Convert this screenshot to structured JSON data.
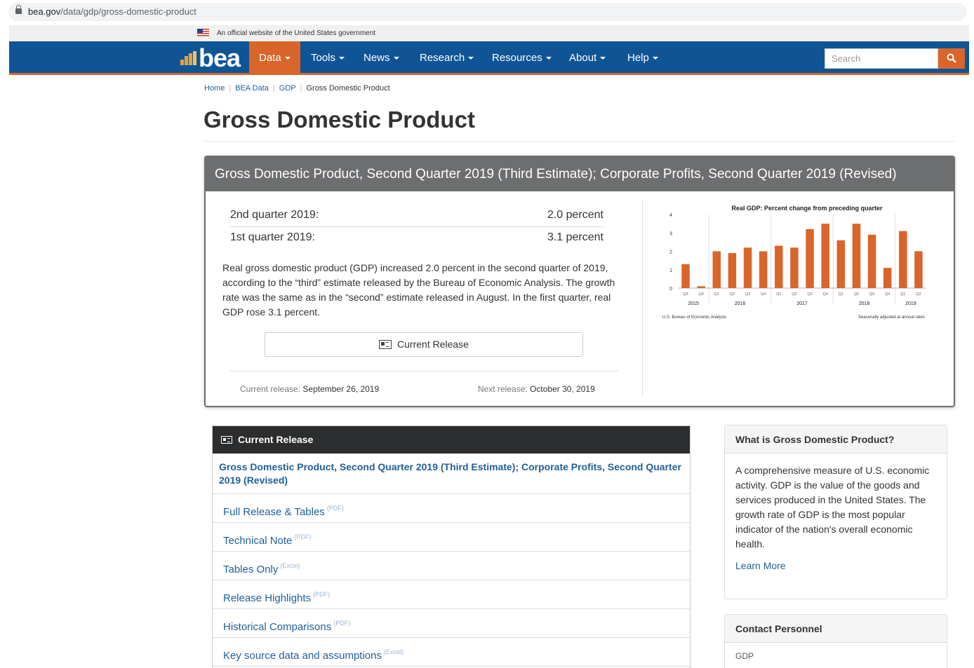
{
  "browser": {
    "url_domain": "bea.gov",
    "url_path": "/data/gdp/gross-domestic-product"
  },
  "gov_banner": "An official website of the United States government",
  "nav": {
    "logo": "bea",
    "items": [
      "Data",
      "Tools",
      "News",
      "Research",
      "Resources",
      "About",
      "Help"
    ],
    "active": "Data",
    "search_placeholder": "Search"
  },
  "breadcrumb": [
    "Home",
    "BEA Data",
    "GDP",
    "Gross Domestic Product"
  ],
  "page_title": "Gross Domestic Product",
  "feature": {
    "heading": "Gross Domestic Product, Second Quarter 2019 (Third Estimate); Corporate Profits, Second Quarter 2019 (Revised)",
    "stats": [
      {
        "label": "2nd quarter 2019:",
        "value": "2.0 percent"
      },
      {
        "label": "1st quarter 2019:",
        "value": "3.1 percent"
      }
    ],
    "summary": "Real gross domestic product (GDP) increased 2.0 percent in the second quarter of 2019, according to the “third” estimate released by the Bureau of Economic Analysis. The growth rate was the same as in the “second” estimate released in August. In the first quarter, real GDP rose 3.1 percent.",
    "button": "Current Release",
    "current_release_label": "Current release:",
    "current_release_date": "September 26, 2019",
    "next_release_label": "Next release:",
    "next_release_date": "October 30, 2019"
  },
  "chart_data": {
    "type": "bar",
    "title": "Real GDP:  Percent change from preceding quarter",
    "categories": [
      "Q3",
      "Q4",
      "Q1",
      "Q2",
      "Q3",
      "Q4",
      "Q1",
      "Q2",
      "Q3",
      "Q4",
      "Q1",
      "Q2",
      "Q3",
      "Q4",
      "Q1",
      "Q2"
    ],
    "years": [
      "2015",
      "2016",
      "2017",
      "2018",
      "2019"
    ],
    "values": [
      1.3,
      0.1,
      2.0,
      1.9,
      2.2,
      2.0,
      2.3,
      2.2,
      3.2,
      3.5,
      2.6,
      3.5,
      2.9,
      1.1,
      3.1,
      2.0
    ],
    "yticks": [
      "0",
      "1",
      "2",
      "3",
      "4"
    ],
    "ylim": [
      0,
      4
    ],
    "bar_color": "#d9652b",
    "source_note": "U.S. Bureau of Economic Analysis",
    "note": "Seasonally adjusted at annual rates"
  },
  "current_release_box": {
    "heading": "Current Release",
    "title": "Gross Domestic Product, Second Quarter 2019 (Third Estimate); Corporate Profits, Second Quarter 2019 (Revised)",
    "links": [
      {
        "label": "Full Release & Tables",
        "tag": "(PDF)"
      },
      {
        "label": "Technical Note",
        "tag": "(PDF)"
      },
      {
        "label": "Tables Only",
        "tag": "(Excel)"
      },
      {
        "label": "Release Highlights",
        "tag": "(PDF)"
      },
      {
        "label": "Historical Comparisons",
        "tag": "(PDF)"
      },
      {
        "label": "Key source data and assumptions",
        "tag": "(Excel)"
      }
    ]
  },
  "sidebar": {
    "what_heading": "What is Gross Domestic Product?",
    "what_text": "A comprehensive measure of U.S. economic activity. GDP is the value of the goods and services produced in the United States. The growth rate of GDP is the most popular indicator of the nation's overall economic health.",
    "learn_more": "Learn More",
    "contact_heading": "Contact Personnel",
    "contact_first": "GDP"
  }
}
